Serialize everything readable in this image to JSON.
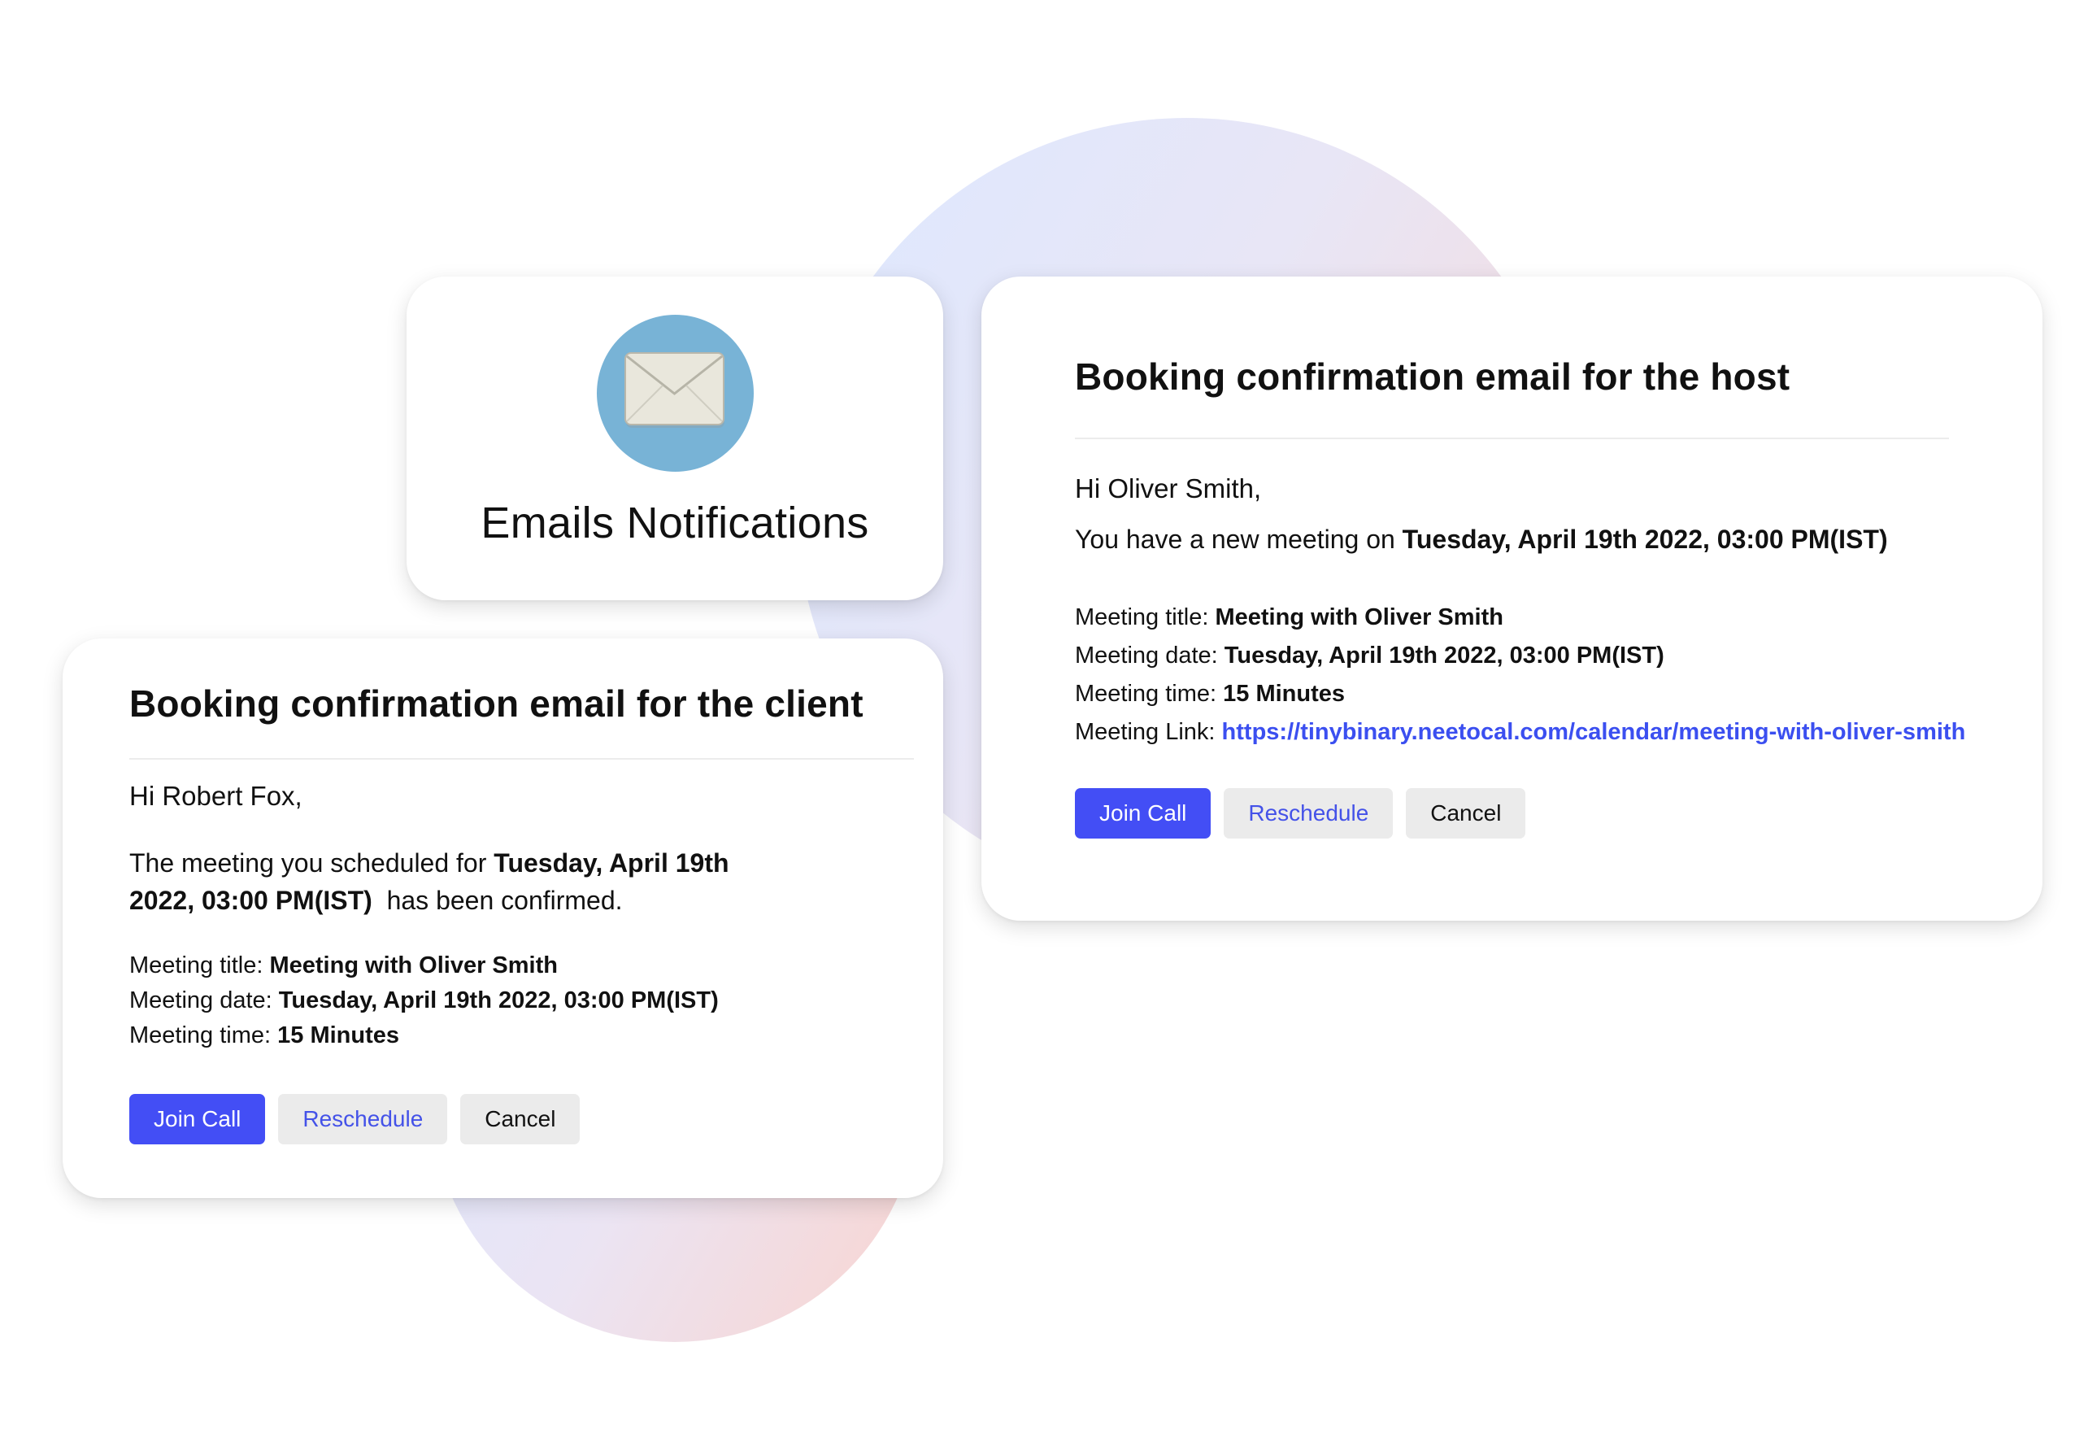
{
  "notifications_card": {
    "icon": "envelope-icon",
    "title": "Emails Notifications"
  },
  "host_email": {
    "title": "Booking confirmation email for the host",
    "greeting": "Hi Oliver Smith,",
    "intro_prefix": "You have a new meeting on ",
    "intro_datetime": "Tuesday, April 19th 2022, 03:00 PM(IST)",
    "details": {
      "title_label": "Meeting title: ",
      "title_value": "Meeting with Oliver Smith",
      "date_label": "Meeting date: ",
      "date_value": "Tuesday, April 19th 2022, 03:00 PM(IST)",
      "time_label": "Meeting time: ",
      "time_value": "15 Minutes",
      "link_label": "Meeting Link: ",
      "link_value": "https://tinybinary.neetocal.com/calendar/meeting-with-oliver-smith"
    },
    "buttons": {
      "join": "Join Call",
      "reschedule": "Reschedule",
      "cancel": "Cancel"
    }
  },
  "client_email": {
    "title": "Booking confirmation email for the client",
    "greeting": "Hi Robert Fox,",
    "intro_prefix": "The meeting you scheduled for ",
    "intro_datetime": "Tuesday, April 19th 2022, 03:00 PM(IST)",
    "intro_suffix": "  has been confirmed.",
    "details": {
      "title_label": "Meeting title: ",
      "title_value": "Meeting with Oliver Smith",
      "date_label": "Meeting date: ",
      "date_value": "Tuesday, April 19th 2022, 03:00 PM(IST)",
      "time_label": "Meeting time: ",
      "time_value": "15 Minutes"
    },
    "buttons": {
      "join": "Join Call",
      "reschedule": "Reschedule",
      "cancel": "Cancel"
    }
  },
  "colors": {
    "primary_button": "#434ef5",
    "secondary_button_bg": "#ebebeb",
    "reschedule_text": "#4452e8",
    "link": "#3b4ff0",
    "envelope_circle": "#78b3d6"
  }
}
